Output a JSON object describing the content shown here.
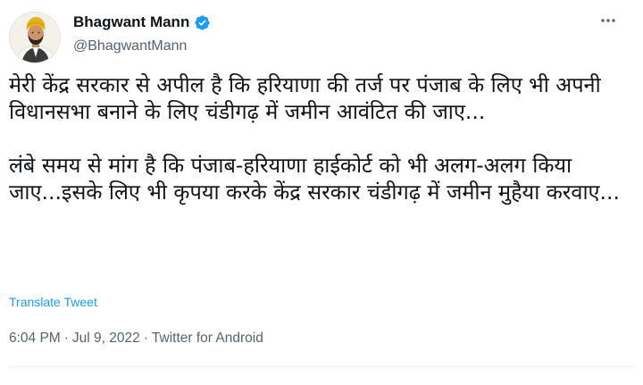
{
  "author": {
    "name": "Bhagwant Mann",
    "handle": "@BhagwantMann",
    "verified": true
  },
  "tweet": {
    "text": "मेरी केंद्र सरकार से अपील है कि हरियाणा की तर्ज पर पंजाब के लिए भी अपनी विधानसभा बनाने के लिए चंडीगढ़ में जमीन आवंटित की जाए...\n\nलंबे समय से मांग है कि पंजाब-हरियाणा हाईकोर्ट को भी अलग-अलग किया जाए...इसके लिए भी कृपया करके केंद्र सरकार चंडीगढ़ में जमीन मुहैया करवाए...",
    "translate_label": "Translate Tweet"
  },
  "meta": {
    "time": "6:04 PM",
    "separator": "·",
    "date": "Jul 9, 2022",
    "source": "Twitter for Android"
  },
  "colors": {
    "accent": "#1d9bf0",
    "secondary_text": "#536471",
    "primary_text": "#0f1419"
  },
  "icons": {
    "verified": "verified-badge-icon",
    "more": "more-options-icon"
  }
}
